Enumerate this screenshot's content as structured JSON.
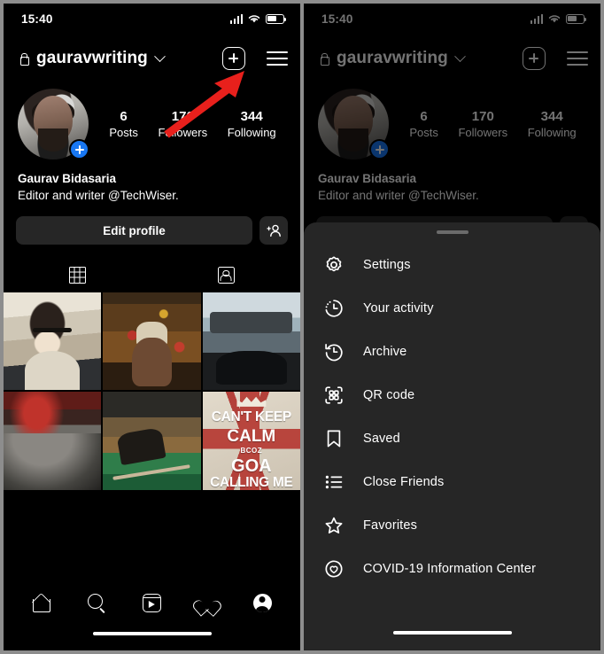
{
  "status_bar": {
    "time": "15:40",
    "icons": [
      "signal-bars-icon",
      "wifi-icon",
      "battery-icon"
    ]
  },
  "profile": {
    "username": "gauravwriting",
    "lock_icon": "lock-icon",
    "chevron_icon": "chevron-down-icon",
    "add_icon": "plus-square-icon",
    "menu_icon": "hamburger-menu-icon",
    "avatar_badge": "plus-badge-icon",
    "stats": [
      {
        "value": "6",
        "label": "Posts"
      },
      {
        "value": "170",
        "label": "Followers"
      },
      {
        "value": "344",
        "label": "Following"
      }
    ],
    "display_name": "Gaurav Bidasaria",
    "bio": "Editor and writer @TechWiser.",
    "edit_button": "Edit profile",
    "add_person_icon": "add-person-icon",
    "tabs": [
      {
        "name": "grid-tab",
        "icon": "grid-icon",
        "active": true
      },
      {
        "name": "tagged-tab",
        "icon": "tagged-icon",
        "active": false
      }
    ],
    "photos": [
      {
        "alt": "man-in-car-with-sunglasses"
      },
      {
        "alt": "man-with-hat-at-christmas-tree"
      },
      {
        "alt": "boats-on-beach-shoreline"
      },
      {
        "alt": "night-road-with-red-light"
      },
      {
        "alt": "billiards-pool-table"
      },
      {
        "alt": "cant-keep-calm-goa-poster"
      }
    ],
    "poster": {
      "line1": "CAN'T KEEP",
      "line2": "CALM",
      "line3": "BCOZ",
      "line4": "GOA",
      "line5": "CALLING ME"
    }
  },
  "bottom_nav": [
    {
      "name": "nav-home",
      "icon": "home-icon"
    },
    {
      "name": "nav-search",
      "icon": "search-icon"
    },
    {
      "name": "nav-reels",
      "icon": "reels-icon"
    },
    {
      "name": "nav-likes",
      "icon": "heart-icon"
    },
    {
      "name": "nav-profile",
      "icon": "profile-avatar-icon"
    }
  ],
  "menu_sheet": {
    "handle": "drag-handle",
    "items": [
      {
        "label": "Settings",
        "icon": "gear-icon"
      },
      {
        "label": "Your activity",
        "icon": "activity-clock-icon"
      },
      {
        "label": "Archive",
        "icon": "archive-clock-icon"
      },
      {
        "label": "QR code",
        "icon": "qr-code-icon"
      },
      {
        "label": "Saved",
        "icon": "bookmark-icon"
      },
      {
        "label": "Close Friends",
        "icon": "list-icon"
      },
      {
        "label": "Favorites",
        "icon": "star-icon"
      },
      {
        "label": "COVID-19 Information Center",
        "icon": "heart-circle-icon"
      }
    ]
  },
  "annotations": {
    "arrow_color": "#e8201c",
    "arrow1_target": "hamburger-menu-icon",
    "arrow2_target": "Settings"
  }
}
